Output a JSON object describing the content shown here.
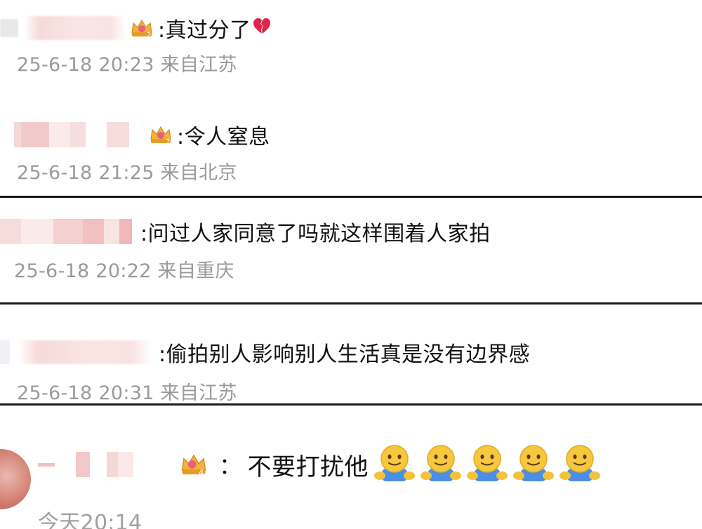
{
  "comments": [
    {
      "text": ":真过分了",
      "emoji": "broken-heart",
      "meta": "25-6-18 20:23 来自江苏",
      "badge_level": "2"
    },
    {
      "text": ":令人窒息",
      "meta": "25-6-18 21:25 来自北京",
      "badge_level": "7"
    },
    {
      "text": ":问过人家同意了吗就这样围着人家拍",
      "meta": "25-6-18 20:22 来自重庆"
    },
    {
      "text": ":偷拍别人影响别人生活真是没有边界感",
      "meta": "25-6-18 20:31 来自江苏"
    },
    {
      "colon": "：",
      "text": "不要打扰他",
      "emoji_repeat": 5,
      "meta": "今天20:14",
      "badge_level": "4"
    }
  ],
  "colors": {
    "divider": "#1a1a1a",
    "meta_text": "#9a9a9a",
    "blur_name": "#f6d6d6",
    "badge_gold": "#f0b43c",
    "badge_pink": "#e8607a"
  }
}
